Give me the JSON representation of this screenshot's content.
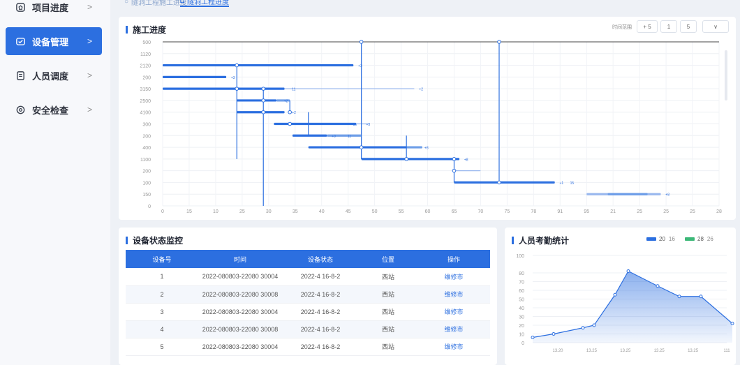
{
  "sidebar": {
    "items": [
      {
        "label": "项目进度",
        "icon": "home-icon",
        "active": false
      },
      {
        "label": "设备管理",
        "icon": "device-icon",
        "active": true
      },
      {
        "label": "人员调度",
        "icon": "document-icon",
        "active": false
      },
      {
        "label": "安全检查",
        "icon": "gear-icon",
        "active": false
      }
    ],
    "chevron": ">"
  },
  "tabs": [
    {
      "label": "隧洞工程施工进度",
      "active": false
    },
    {
      "label": "隧洞工程进度",
      "active": true
    }
  ],
  "gantt": {
    "title": "施工进度",
    "control_label": "时间范围",
    "controls": [
      "+ 5",
      "1",
      "5"
    ],
    "dropdown": "∨",
    "y_labels": [
      "500",
      "1120",
      "2120",
      "200",
      "3150",
      "2500",
      "4100",
      "300",
      "200",
      "400",
      "1100",
      "200",
      "100",
      "150",
      "0"
    ],
    "x_labels": [
      "0",
      "15",
      "10",
      "25",
      "30",
      "35",
      "40",
      "45",
      "50",
      "55",
      "60",
      "65",
      "70",
      "75",
      "78",
      "91",
      "95",
      "21",
      "25",
      "25",
      "25",
      "28"
    ],
    "bar_tags": [
      "+3",
      "+3",
      "11",
      "+2",
      "+2",
      "+2",
      "+3",
      "+0",
      "+8",
      "+1",
      "15",
      "+8",
      "+8",
      "11",
      "15"
    ]
  },
  "device_table": {
    "title": "设备状态监控",
    "columns": [
      "设备号",
      "时间",
      "设备状态",
      "位置",
      "操作"
    ],
    "rows": [
      [
        "1",
        "2022-080803-22080 30004",
        "2022-4 16-8-2",
        "西站",
        "维修市"
      ],
      [
        "2",
        "2022-080803-22080 30008",
        "2022-4 16-8-2",
        "西站",
        "维修市"
      ],
      [
        "3",
        "2022-080803-22080 30004",
        "2022-4 16-8-2",
        "西站",
        "维修市"
      ],
      [
        "4",
        "2022-080803-22080 30008",
        "2022-4 16-8-2",
        "西站",
        "维修市"
      ],
      [
        "5",
        "2022-080803-22080 30004",
        "2022-4 16-8-2",
        "西站",
        "维修市"
      ]
    ]
  },
  "attendance": {
    "title": "人员考勤统计",
    "legend": [
      {
        "label": "20",
        "suffix": "16",
        "color": "#2c6fe0"
      },
      {
        "label": "28",
        "suffix": "26",
        "color": "#3cb878"
      }
    ]
  },
  "chart_data": {
    "type": "area",
    "title": "人员考勤统计",
    "x": [
      "13.20",
      "13.25",
      "13.25",
      "13.25",
      "13.25",
      "111"
    ],
    "series": [
      {
        "name": "20",
        "values": [
          6,
          10,
          17,
          20,
          55,
          82,
          65,
          53,
          53,
          22
        ]
      }
    ],
    "ylim": [
      0,
      100
    ],
    "yticks": [
      0,
      10,
      20,
      30,
      40,
      50,
      60,
      70,
      80,
      100
    ]
  },
  "colors": {
    "accent": "#2c6fe0",
    "green": "#3cb878"
  }
}
